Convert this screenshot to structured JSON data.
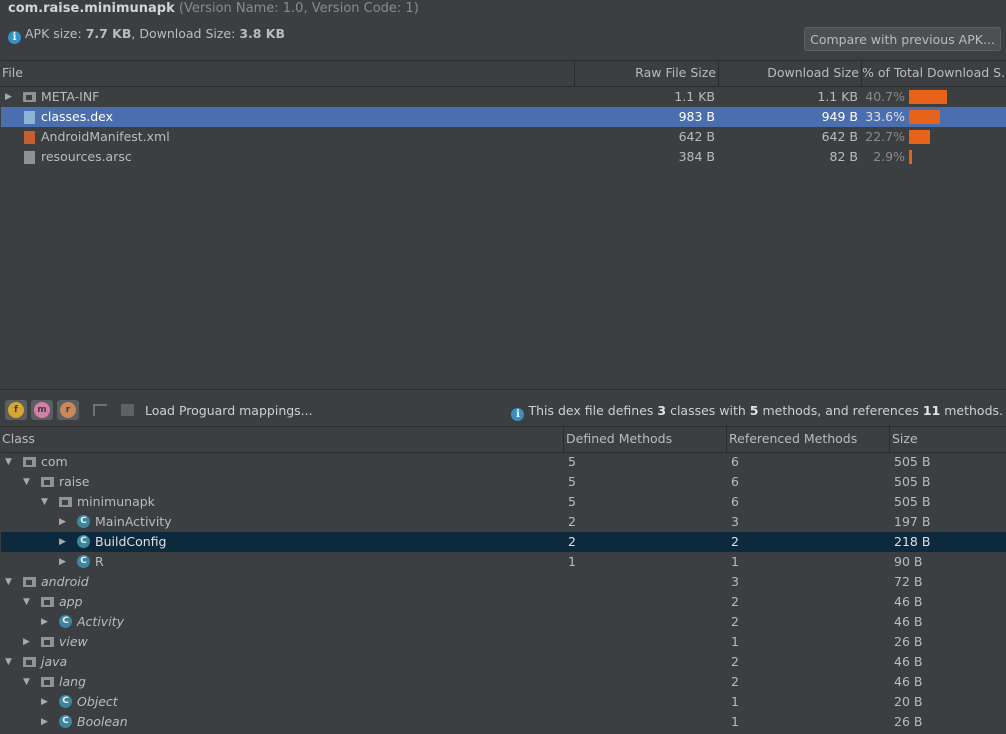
{
  "header": {
    "package": "com.raise.minimunapk",
    "version_text": "(Version Name: 1.0, Version Code: 1)",
    "apk_size_label": "APK size: ",
    "apk_size": "7.7 KB",
    "download_label": ", Download Size: ",
    "download_size": "3.8 KB",
    "compare_button": "Compare with previous APK..."
  },
  "files_table": {
    "columns": [
      "File",
      "Raw File Size",
      "Download Size",
      "% of Total Download S..."
    ],
    "rows": [
      {
        "name": "META-INF",
        "raw": "1.1 KB",
        "download": "1.1 KB",
        "pct": "40.7%",
        "pct_value": 40.7,
        "expandable": true,
        "selected": false,
        "icon": "folder-icon"
      },
      {
        "name": "classes.dex",
        "raw": "983 B",
        "download": "949 B",
        "pct": "33.6%",
        "pct_value": 33.6,
        "expandable": false,
        "selected": true,
        "icon": "dex-file-icon"
      },
      {
        "name": "AndroidManifest.xml",
        "raw": "642 B",
        "download": "642 B",
        "pct": "22.7%",
        "pct_value": 22.7,
        "expandable": false,
        "selected": false,
        "icon": "xml-file-icon"
      },
      {
        "name": "resources.arsc",
        "raw": "384 B",
        "download": "82 B",
        "pct": "2.9%",
        "pct_value": 2.9,
        "expandable": false,
        "selected": false,
        "icon": "unknown-file-icon"
      }
    ]
  },
  "toolbar": {
    "load_proguard": "Load Proguard mappings...",
    "info_prefix": "This dex file defines ",
    "classes_count": "3",
    "info_mid1": " classes with ",
    "methods_count": "5",
    "info_mid2": " methods, and references ",
    "ref_count": "11",
    "info_suffix": " methods."
  },
  "classes_table": {
    "columns": [
      "Class",
      "Defined Methods",
      "Referenced Methods",
      "Size"
    ],
    "rows": [
      {
        "name": "com",
        "depth": 0,
        "kind": "package",
        "expanded": true,
        "italic": false,
        "defined": "5",
        "referenced": "6",
        "size": "505 B"
      },
      {
        "name": "raise",
        "depth": 1,
        "kind": "package",
        "expanded": true,
        "italic": false,
        "defined": "5",
        "referenced": "6",
        "size": "505 B"
      },
      {
        "name": "minimunapk",
        "depth": 2,
        "kind": "package",
        "expanded": true,
        "italic": false,
        "defined": "5",
        "referenced": "6",
        "size": "505 B"
      },
      {
        "name": "MainActivity",
        "depth": 3,
        "kind": "class",
        "expanded": false,
        "italic": false,
        "defined": "2",
        "referenced": "3",
        "size": "197 B"
      },
      {
        "name": "BuildConfig",
        "depth": 3,
        "kind": "class",
        "expanded": false,
        "italic": false,
        "defined": "2",
        "referenced": "2",
        "size": "218 B",
        "selected": true
      },
      {
        "name": "R",
        "depth": 3,
        "kind": "class",
        "expanded": false,
        "italic": false,
        "defined": "1",
        "referenced": "1",
        "size": "90 B"
      },
      {
        "name": "android",
        "depth": 0,
        "kind": "package",
        "expanded": true,
        "italic": true,
        "defined": "",
        "referenced": "3",
        "size": "72 B"
      },
      {
        "name": "app",
        "depth": 1,
        "kind": "package",
        "expanded": true,
        "italic": true,
        "defined": "",
        "referenced": "2",
        "size": "46 B"
      },
      {
        "name": "Activity",
        "depth": 2,
        "kind": "class",
        "expanded": false,
        "italic": true,
        "defined": "",
        "referenced": "2",
        "size": "46 B"
      },
      {
        "name": "view",
        "depth": 1,
        "kind": "package",
        "expanded": false,
        "italic": true,
        "defined": "",
        "referenced": "1",
        "size": "26 B"
      },
      {
        "name": "java",
        "depth": 0,
        "kind": "package",
        "expanded": true,
        "italic": true,
        "defined": "",
        "referenced": "2",
        "size": "46 B"
      },
      {
        "name": "lang",
        "depth": 1,
        "kind": "package",
        "expanded": true,
        "italic": true,
        "defined": "",
        "referenced": "2",
        "size": "46 B"
      },
      {
        "name": "Object",
        "depth": 2,
        "kind": "class",
        "expanded": false,
        "italic": true,
        "defined": "",
        "referenced": "1",
        "size": "20 B"
      },
      {
        "name": "Boolean",
        "depth": 2,
        "kind": "class",
        "expanded": false,
        "italic": true,
        "defined": "",
        "referenced": "1",
        "size": "26 B"
      }
    ]
  },
  "colors": {
    "background": "#3c3f41",
    "selection_top": "#4b6eaf",
    "selection_bottom": "#0d293e",
    "bar": "#e8631a",
    "class_icon": "#3e86a0"
  }
}
